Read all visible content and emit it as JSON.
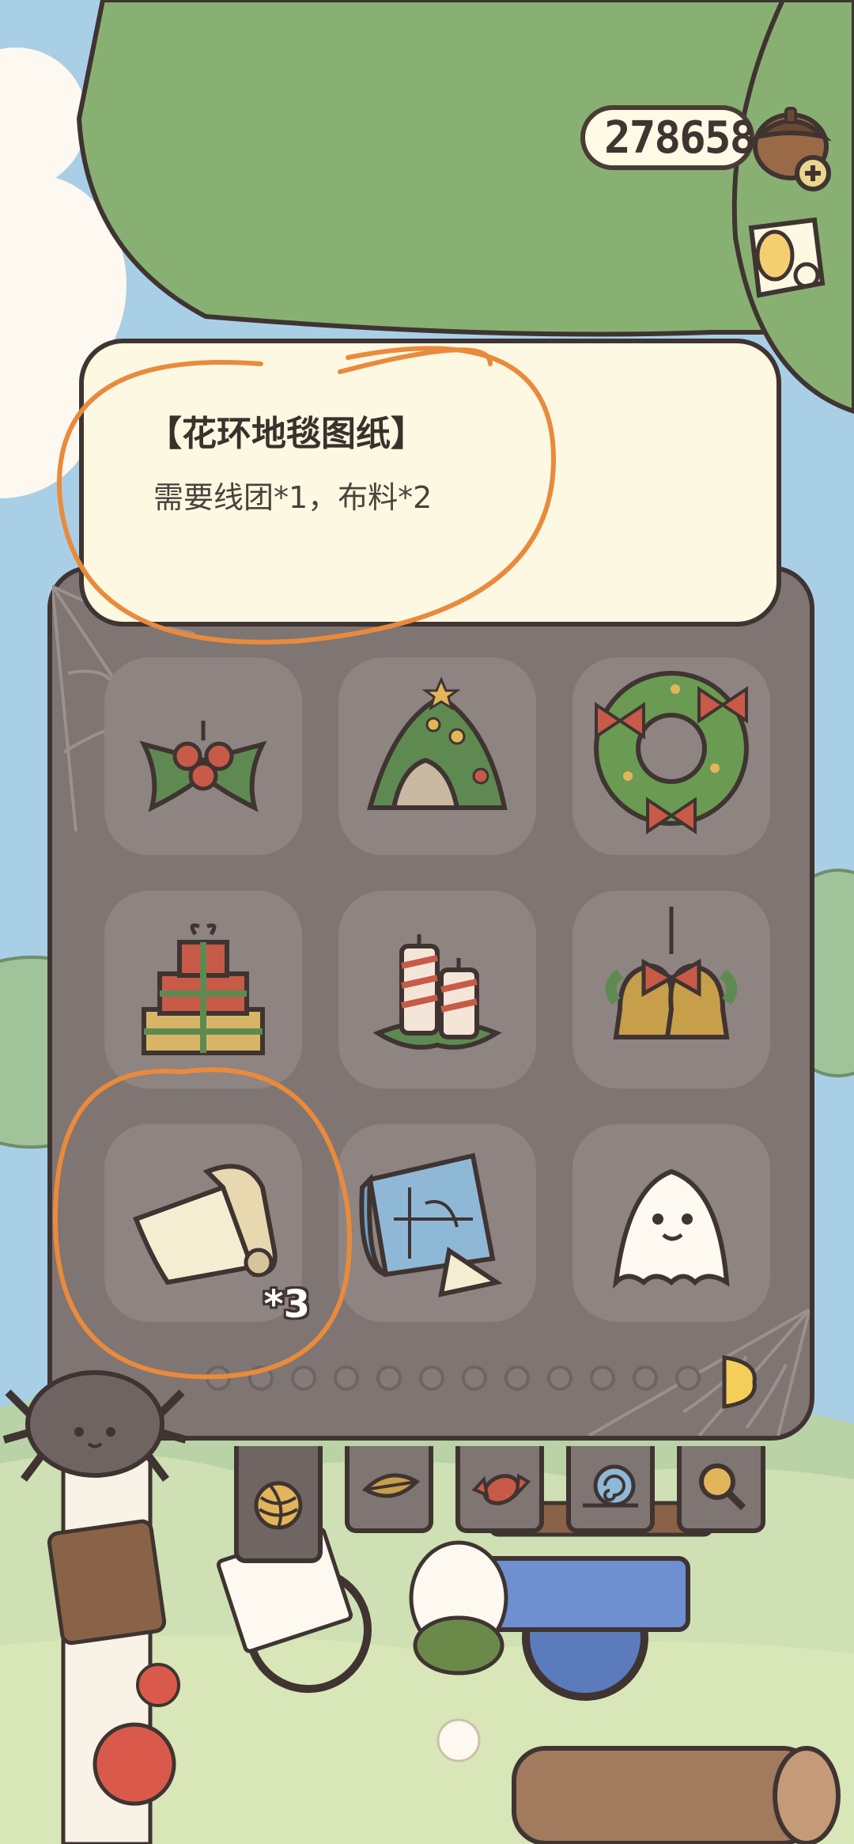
{
  "currency": {
    "amount": "278658"
  },
  "tooltip": {
    "title": "【花环地毯图纸】",
    "description": "需要线团*1，布料*2"
  },
  "inventory": {
    "slots": [
      {
        "name": "holly-icon"
      },
      {
        "name": "christmas-tree-tent-icon"
      },
      {
        "name": "christmas-wreath-icon"
      },
      {
        "name": "gift-boxes-icon"
      },
      {
        "name": "candles-icon"
      },
      {
        "name": "bells-icon"
      },
      {
        "name": "fabric-roll-icon",
        "badge": "*3"
      },
      {
        "name": "blueprint-icon"
      },
      {
        "name": "ghost-icon"
      }
    ],
    "page_dots": 12
  },
  "tabs": [
    {
      "name": "yarn-ball-icon",
      "active": true
    },
    {
      "name": "leaf-icon",
      "active": false
    },
    {
      "name": "candy-icon",
      "active": false
    },
    {
      "name": "snail-shell-icon",
      "active": false
    },
    {
      "name": "magnifier-icon",
      "active": false
    }
  ],
  "colors": {
    "panel": "#7f7573",
    "slot": "#8e8482",
    "tooltip": "#fdf8e2",
    "outline": "#3f3431",
    "highlight_circle": "#e98a3c",
    "tree_green": "#88b072"
  }
}
